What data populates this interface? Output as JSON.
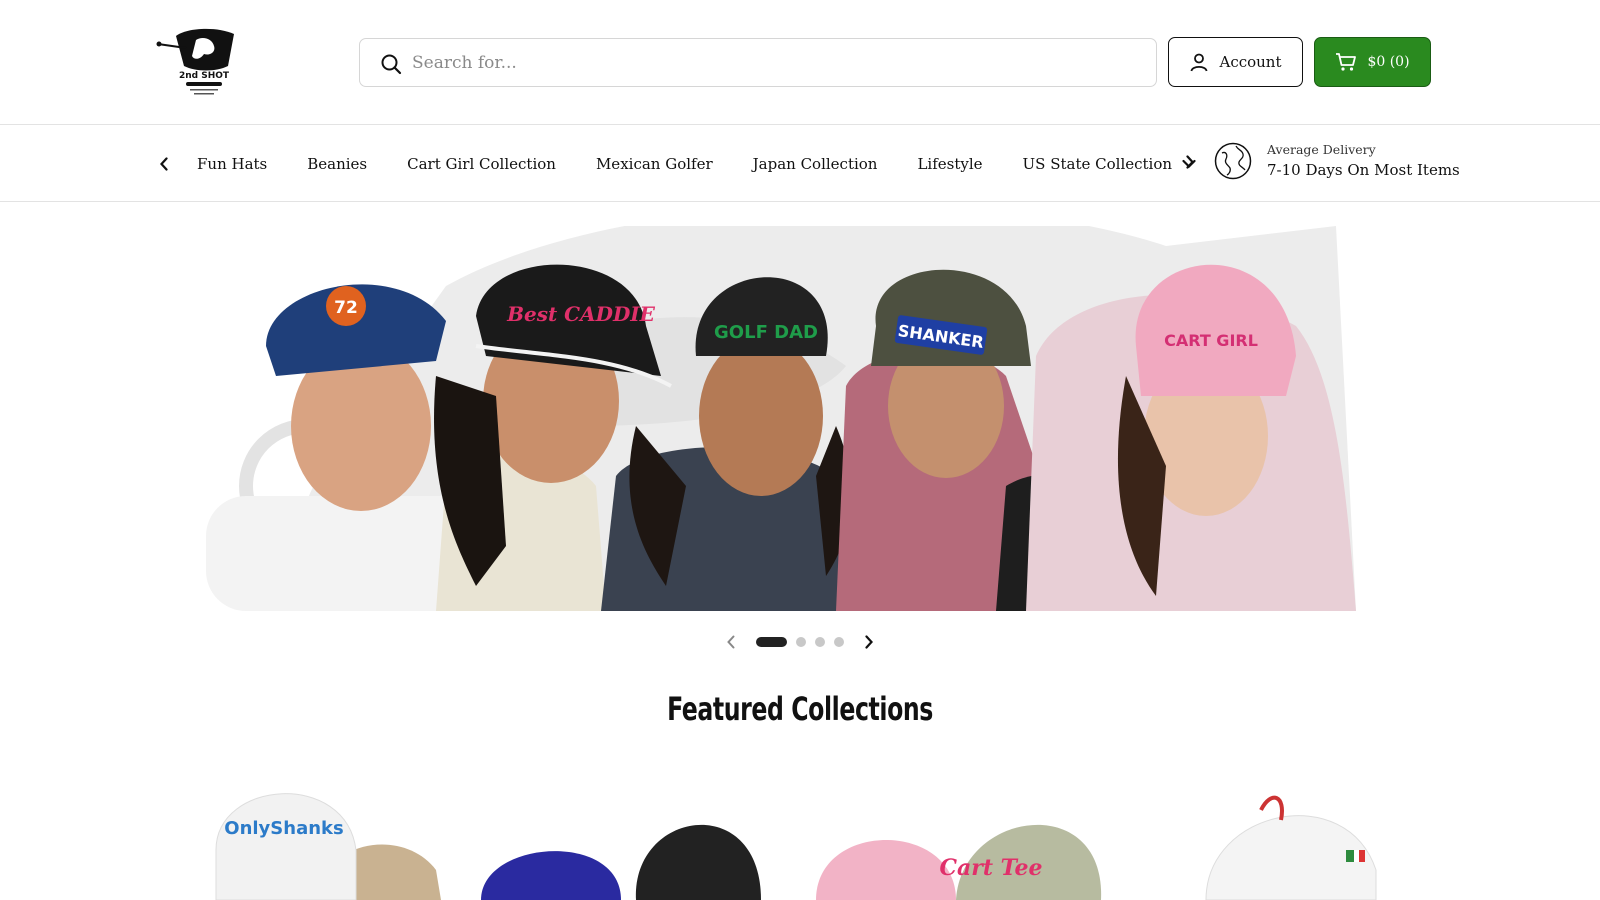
{
  "header": {
    "logo_alt": "2nd SHOT",
    "search": {
      "placeholder": "Search for..."
    },
    "account_label": "Account",
    "cart_label": "$0 (0)"
  },
  "nav": {
    "items": [
      {
        "label": "Fun Hats"
      },
      {
        "label": "Beanies"
      },
      {
        "label": "Cart Girl Collection"
      },
      {
        "label": "Mexican Golfer"
      },
      {
        "label": "Japan Collection"
      },
      {
        "label": "Lifestyle"
      },
      {
        "label": "US State Collection",
        "has_dropdown": true
      }
    ],
    "delivery": {
      "small": "Average Delivery",
      "big": "7-10 Days On Most Items"
    }
  },
  "hero": {
    "slide_count": 4,
    "active_slide": 1,
    "hat_texts": [
      "72",
      "Best CADDIE",
      "GOLF DAD",
      "SHANKER",
      "CART GIRL"
    ]
  },
  "featured": {
    "title": "Featured Collections",
    "card_texts": [
      "OnlyShanks",
      "Cart Tee"
    ]
  },
  "colors": {
    "cart_green": "#2a8a1f",
    "text": "#111111",
    "border": "#d6d6d6"
  },
  "icons": [
    "logo",
    "search-icon",
    "user-icon",
    "cart-icon",
    "chevron-left-icon",
    "chevron-right-icon",
    "chevron-down-icon",
    "globe-icon"
  ]
}
